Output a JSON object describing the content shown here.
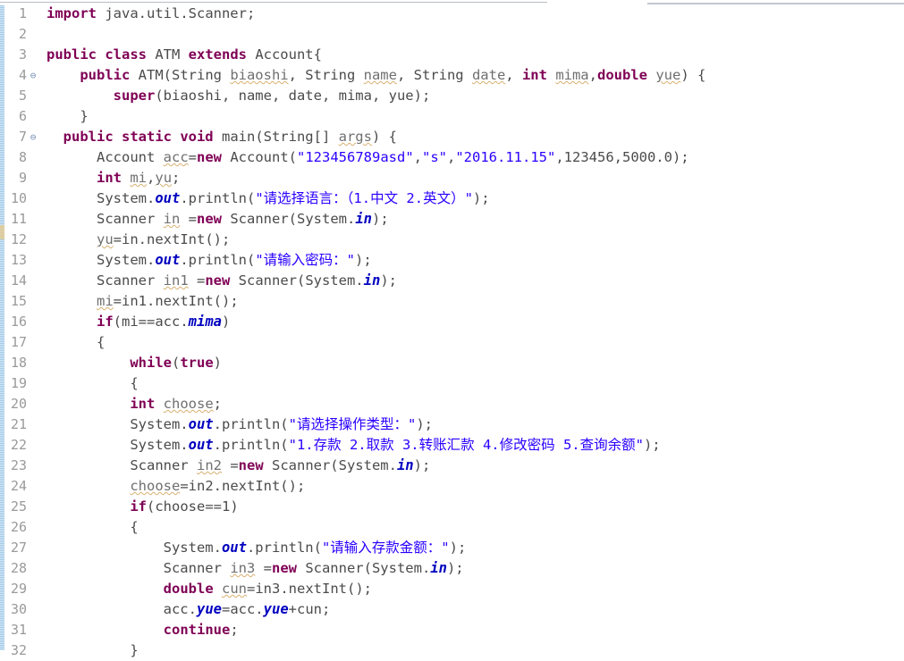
{
  "editor": {
    "name": "java-source-editor",
    "language": "Java",
    "colors": {
      "background": "#ffffff",
      "keyword": "#7f0055",
      "string": "#2a00ff",
      "field": "#0000c0",
      "plain": "#4b4b4b",
      "gutter_text": "#9a9a9a",
      "change_bar": "#9fc8e8",
      "warning_underline": "#d8b070"
    },
    "gutter": {
      "first_line": 1,
      "last_line": 32,
      "fold_marker_glyph": "⊖",
      "fold_marker_lines": [
        4,
        7
      ]
    },
    "lines": [
      {
        "number": "1",
        "fold": false,
        "tokens": [
          {
            "t": "kw",
            "v": "import"
          },
          {
            "t": "pln",
            "v": " java.util.Scanner;"
          }
        ]
      },
      {
        "number": "2",
        "fold": false,
        "tokens": []
      },
      {
        "number": "3",
        "fold": false,
        "tokens": [
          {
            "t": "kw",
            "v": "public class"
          },
          {
            "t": "pln",
            "v": " ATM "
          },
          {
            "t": "kw",
            "v": "extends"
          },
          {
            "t": "pln",
            "v": " Account{"
          }
        ]
      },
      {
        "number": "4",
        "fold": true,
        "tokens": [
          {
            "t": "pln",
            "v": "    "
          },
          {
            "t": "kw",
            "v": "public"
          },
          {
            "t": "pln",
            "v": " ATM(String "
          },
          {
            "t": "var",
            "v": "biaoshi"
          },
          {
            "t": "pln",
            "v": ", String "
          },
          {
            "t": "var",
            "v": "name"
          },
          {
            "t": "pln",
            "v": ", String "
          },
          {
            "t": "var",
            "v": "date"
          },
          {
            "t": "pln",
            "v": ", "
          },
          {
            "t": "kw",
            "v": "int"
          },
          {
            "t": "pln",
            "v": " "
          },
          {
            "t": "var",
            "v": "mima"
          },
          {
            "t": "pln",
            "v": ","
          },
          {
            "t": "kw",
            "v": "double"
          },
          {
            "t": "pln",
            "v": " "
          },
          {
            "t": "var",
            "v": "yue"
          },
          {
            "t": "pln",
            "v": ") {"
          }
        ]
      },
      {
        "number": "5",
        "fold": false,
        "tokens": [
          {
            "t": "pln",
            "v": "        "
          },
          {
            "t": "kw",
            "v": "super"
          },
          {
            "t": "pln",
            "v": "(biaoshi, name, date, mima, yue);"
          }
        ]
      },
      {
        "number": "6",
        "fold": false,
        "tokens": [
          {
            "t": "pln",
            "v": "    }"
          }
        ]
      },
      {
        "number": "7",
        "fold": true,
        "tokens": [
          {
            "t": "pln",
            "v": "  "
          },
          {
            "t": "kw",
            "v": "public static void"
          },
          {
            "t": "pln",
            "v": " main(String[] "
          },
          {
            "t": "var",
            "v": "args"
          },
          {
            "t": "pln",
            "v": ") {"
          }
        ]
      },
      {
        "number": "8",
        "fold": false,
        "tokens": [
          {
            "t": "pln",
            "v": "      Account "
          },
          {
            "t": "var",
            "v": "acc"
          },
          {
            "t": "pln",
            "v": "="
          },
          {
            "t": "kw",
            "v": "new"
          },
          {
            "t": "pln",
            "v": " Account("
          },
          {
            "t": "str",
            "v": "\"123456789asd\""
          },
          {
            "t": "pln",
            "v": ","
          },
          {
            "t": "str",
            "v": "\"s\""
          },
          {
            "t": "pln",
            "v": ","
          },
          {
            "t": "str",
            "v": "\"2016.11.15\""
          },
          {
            "t": "pln",
            "v": ",123456,5000.0);"
          }
        ]
      },
      {
        "number": "9",
        "fold": false,
        "tokens": [
          {
            "t": "pln",
            "v": "      "
          },
          {
            "t": "kw",
            "v": "int"
          },
          {
            "t": "pln",
            "v": " "
          },
          {
            "t": "var",
            "v": "mi"
          },
          {
            "t": "pln",
            "v": ","
          },
          {
            "t": "var",
            "v": "yu"
          },
          {
            "t": "pln",
            "v": ";"
          }
        ]
      },
      {
        "number": "10",
        "fold": false,
        "tokens": [
          {
            "t": "pln",
            "v": "      System."
          },
          {
            "t": "fld",
            "v": "out"
          },
          {
            "t": "pln",
            "v": ".println("
          },
          {
            "t": "str",
            "v": "\"请选择语言：（1.中文 2.英文）\""
          },
          {
            "t": "pln",
            "v": ");"
          }
        ]
      },
      {
        "number": "11",
        "fold": false,
        "tokens": [
          {
            "t": "pln",
            "v": "      Scanner "
          },
          {
            "t": "var",
            "v": "in"
          },
          {
            "t": "pln",
            "v": " ="
          },
          {
            "t": "kw",
            "v": "new"
          },
          {
            "t": "pln",
            "v": " Scanner(System."
          },
          {
            "t": "fld",
            "v": "in"
          },
          {
            "t": "pln",
            "v": ");"
          }
        ]
      },
      {
        "number": "12",
        "fold": false,
        "tokens": [
          {
            "t": "pln",
            "v": "      "
          },
          {
            "t": "var",
            "v": "yu"
          },
          {
            "t": "pln",
            "v": "=in.nextInt();"
          }
        ]
      },
      {
        "number": "13",
        "fold": false,
        "tokens": [
          {
            "t": "pln",
            "v": "      System."
          },
          {
            "t": "fld",
            "v": "out"
          },
          {
            "t": "pln",
            "v": ".println("
          },
          {
            "t": "str",
            "v": "\"请输入密码：\""
          },
          {
            "t": "pln",
            "v": ");"
          }
        ]
      },
      {
        "number": "14",
        "fold": false,
        "tokens": [
          {
            "t": "pln",
            "v": "      Scanner "
          },
          {
            "t": "var",
            "v": "in1"
          },
          {
            "t": "pln",
            "v": " ="
          },
          {
            "t": "kw",
            "v": "new"
          },
          {
            "t": "pln",
            "v": " Scanner(System."
          },
          {
            "t": "fld",
            "v": "in"
          },
          {
            "t": "pln",
            "v": ");"
          }
        ]
      },
      {
        "number": "15",
        "fold": false,
        "tokens": [
          {
            "t": "pln",
            "v": "      "
          },
          {
            "t": "var",
            "v": "mi"
          },
          {
            "t": "pln",
            "v": "=in1.nextInt();"
          }
        ]
      },
      {
        "number": "16",
        "fold": false,
        "tokens": [
          {
            "t": "pln",
            "v": "      "
          },
          {
            "t": "kw",
            "v": "if"
          },
          {
            "t": "pln",
            "v": "(mi==acc."
          },
          {
            "t": "fldp",
            "v": "mima"
          },
          {
            "t": "pln",
            "v": ")"
          }
        ]
      },
      {
        "number": "17",
        "fold": false,
        "tokens": [
          {
            "t": "pln",
            "v": "      {"
          }
        ]
      },
      {
        "number": "18",
        "fold": false,
        "tokens": [
          {
            "t": "pln",
            "v": "          "
          },
          {
            "t": "kw",
            "v": "while"
          },
          {
            "t": "pln",
            "v": "("
          },
          {
            "t": "kw",
            "v": "true"
          },
          {
            "t": "pln",
            "v": ")"
          }
        ]
      },
      {
        "number": "19",
        "fold": false,
        "tokens": [
          {
            "t": "pln",
            "v": "          {"
          }
        ]
      },
      {
        "number": "20",
        "fold": false,
        "tokens": [
          {
            "t": "pln",
            "v": "          "
          },
          {
            "t": "kw",
            "v": "int"
          },
          {
            "t": "pln",
            "v": " "
          },
          {
            "t": "var",
            "v": "choose"
          },
          {
            "t": "pln",
            "v": ";"
          }
        ]
      },
      {
        "number": "21",
        "fold": false,
        "tokens": [
          {
            "t": "pln",
            "v": "          System."
          },
          {
            "t": "fld",
            "v": "out"
          },
          {
            "t": "pln",
            "v": ".println("
          },
          {
            "t": "str",
            "v": "\"请选择操作类型：\""
          },
          {
            "t": "pln",
            "v": ");"
          }
        ]
      },
      {
        "number": "22",
        "fold": false,
        "tokens": [
          {
            "t": "pln",
            "v": "          System."
          },
          {
            "t": "fld",
            "v": "out"
          },
          {
            "t": "pln",
            "v": ".println("
          },
          {
            "t": "str",
            "v": "\"1.存款 2.取款 3.转账汇款 4.修改密码 5.查询余额\""
          },
          {
            "t": "pln",
            "v": ");"
          }
        ]
      },
      {
        "number": "23",
        "fold": false,
        "tokens": [
          {
            "t": "pln",
            "v": "          Scanner "
          },
          {
            "t": "var",
            "v": "in2"
          },
          {
            "t": "pln",
            "v": " ="
          },
          {
            "t": "kw",
            "v": "new"
          },
          {
            "t": "pln",
            "v": " Scanner(System."
          },
          {
            "t": "fld",
            "v": "in"
          },
          {
            "t": "pln",
            "v": ");"
          }
        ]
      },
      {
        "number": "24",
        "fold": false,
        "tokens": [
          {
            "t": "pln",
            "v": "          "
          },
          {
            "t": "var",
            "v": "choose"
          },
          {
            "t": "pln",
            "v": "=in2.nextInt();"
          }
        ]
      },
      {
        "number": "25",
        "fold": false,
        "tokens": [
          {
            "t": "pln",
            "v": "          "
          },
          {
            "t": "kw",
            "v": "if"
          },
          {
            "t": "pln",
            "v": "(choose==1)"
          }
        ]
      },
      {
        "number": "26",
        "fold": false,
        "tokens": [
          {
            "t": "pln",
            "v": "          {"
          }
        ]
      },
      {
        "number": "27",
        "fold": false,
        "tokens": [
          {
            "t": "pln",
            "v": "              System."
          },
          {
            "t": "fld",
            "v": "out"
          },
          {
            "t": "pln",
            "v": ".println("
          },
          {
            "t": "str",
            "v": "\"请输入存款金额：\""
          },
          {
            "t": "pln",
            "v": ");"
          }
        ]
      },
      {
        "number": "28",
        "fold": false,
        "tokens": [
          {
            "t": "pln",
            "v": "              Scanner "
          },
          {
            "t": "var",
            "v": "in3"
          },
          {
            "t": "pln",
            "v": " ="
          },
          {
            "t": "kw",
            "v": "new"
          },
          {
            "t": "pln",
            "v": " Scanner(System."
          },
          {
            "t": "fld",
            "v": "in"
          },
          {
            "t": "pln",
            "v": ");"
          }
        ]
      },
      {
        "number": "29",
        "fold": false,
        "tokens": [
          {
            "t": "pln",
            "v": "              "
          },
          {
            "t": "kw",
            "v": "double"
          },
          {
            "t": "pln",
            "v": " "
          },
          {
            "t": "var",
            "v": "cun"
          },
          {
            "t": "pln",
            "v": "=in3.nextInt();"
          }
        ]
      },
      {
        "number": "30",
        "fold": false,
        "tokens": [
          {
            "t": "pln",
            "v": "              acc."
          },
          {
            "t": "fldp",
            "v": "yue"
          },
          {
            "t": "pln",
            "v": "=acc."
          },
          {
            "t": "fldp",
            "v": "yue"
          },
          {
            "t": "pln",
            "v": "+cun;"
          }
        ]
      },
      {
        "number": "31",
        "fold": false,
        "tokens": [
          {
            "t": "pln",
            "v": "              "
          },
          {
            "t": "kw",
            "v": "continue"
          },
          {
            "t": "pln",
            "v": ";"
          }
        ]
      },
      {
        "number": "32",
        "fold": false,
        "tokens": [
          {
            "t": "pln",
            "v": "          }"
          }
        ]
      }
    ]
  }
}
